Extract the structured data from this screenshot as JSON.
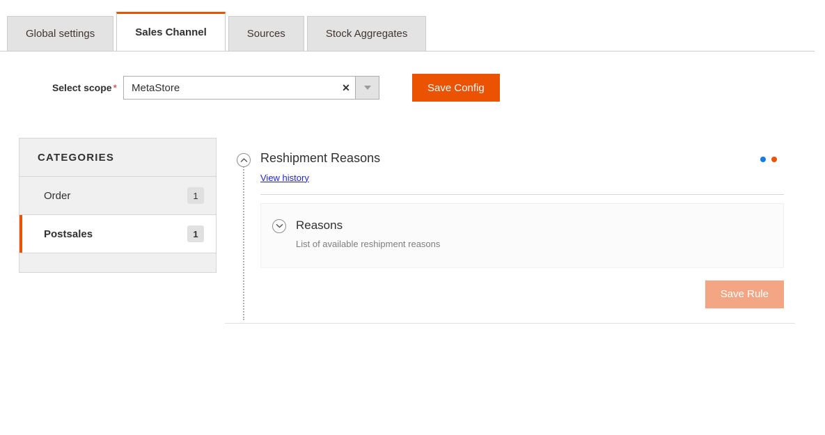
{
  "tabs": [
    {
      "label": "Global settings",
      "active": false
    },
    {
      "label": "Sales Channel",
      "active": true
    },
    {
      "label": "Sources",
      "active": false
    },
    {
      "label": "Stock Aggregates",
      "active": false
    }
  ],
  "scope": {
    "label": "Select scope",
    "required_marker": "*",
    "value": "MetaStore",
    "clear_glyph": "✕",
    "save_button": "Save Config"
  },
  "sidebar": {
    "header": "CATEGORIES",
    "items": [
      {
        "label": "Order",
        "badge": "1",
        "active": false
      },
      {
        "label": "Postsales",
        "badge": "1",
        "active": true
      }
    ]
  },
  "section": {
    "title": "Reshipment Reasons",
    "history_link": "View history",
    "dots": [
      {
        "name": "status-dot-blue",
        "color": "#1979e6"
      },
      {
        "name": "status-dot-orange",
        "color": "#eb5202"
      }
    ],
    "card": {
      "title": "Reasons",
      "description": "List of available reshipment reasons"
    },
    "save_rule_button": "Save Rule"
  },
  "colors": {
    "accent_orange": "#eb5202",
    "accent_orange_disabled": "#f3a584",
    "link_blue": "#2222dd",
    "required_red": "#e22626",
    "sidebar_bg": "#f0f0f0",
    "card_bg": "#fbfbfb",
    "border_grey": "#d6d6d6"
  }
}
